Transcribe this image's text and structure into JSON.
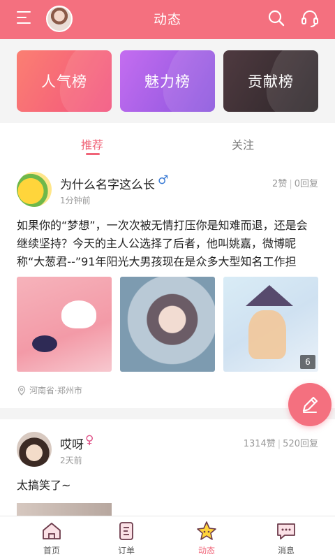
{
  "header": {
    "title": "动态",
    "menu_icon": "hamburger-menu-icon",
    "search_icon": "search-icon",
    "service_icon": "headset-icon"
  },
  "ranks": [
    {
      "label": "人气榜",
      "color": "#f4677d"
    },
    {
      "label": "魅力榜",
      "color": "#a45fe6"
    },
    {
      "label": "贡献榜",
      "color": "#3a2f34"
    }
  ],
  "tabs": [
    {
      "label": "推荐",
      "active": true
    },
    {
      "label": "关注",
      "active": false
    }
  ],
  "posts": [
    {
      "username": "为什么名字这么长",
      "gender_symbol": "♂",
      "time": "1分钟前",
      "likes": "2赞",
      "replies": "0回复",
      "content": "如果你的“梦想”，一次次被无情打压你是知难而退，还是会继续坚持？今天的主人公选择了后者，他叫姚嘉，微博昵称“大葱君--”91年阳光大男孩现在是众多大型知名工作担",
      "photo_count": "6",
      "location": "河南省·郑州市"
    },
    {
      "username": "哎呀",
      "gender_symbol": "♀",
      "time": "2天前",
      "likes": "1314赞",
      "replies": "520回复",
      "content": "太搞笑了~"
    }
  ],
  "nav": [
    {
      "label": "首页",
      "icon": "home-icon"
    },
    {
      "label": "订单",
      "icon": "order-icon"
    },
    {
      "label": "动态",
      "icon": "star-icon",
      "active": true
    },
    {
      "label": "消息",
      "icon": "message-icon"
    }
  ],
  "colors": {
    "brand": "#f4707f",
    "active_tab": "#f06478",
    "male": "#3a7bd5",
    "female": "#e0558a"
  }
}
